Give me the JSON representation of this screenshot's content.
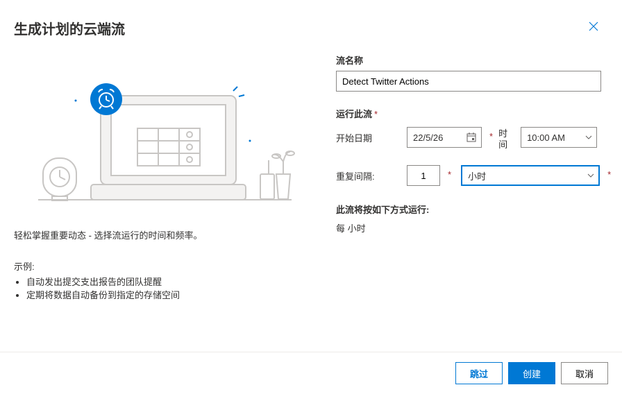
{
  "header": {
    "title": "生成计划的云端流"
  },
  "left": {
    "description": "轻松掌握重要动态 - 选择流运行的时间和频率。",
    "example_heading": "示例:",
    "examples": [
      "自动发出提交支出报告的团队提醒",
      "定期将数据自动备份到指定的存储空间"
    ]
  },
  "form": {
    "flow_name_label": "流名称",
    "flow_name_value": "Detect Twitter Actions",
    "run_label": "运行此流",
    "start_date_label": "开始日期",
    "start_date_value": "22/5/26",
    "time_label": "时间",
    "time_value": "10:00 AM",
    "repeat_label": "重复间隔:",
    "repeat_value": "1",
    "repeat_unit": "小时",
    "runs_as_label": "此流将按如下方式运行:",
    "runs_as_text": "每 小时"
  },
  "footer": {
    "skip": "跳过",
    "create": "创建",
    "cancel": "取消"
  }
}
